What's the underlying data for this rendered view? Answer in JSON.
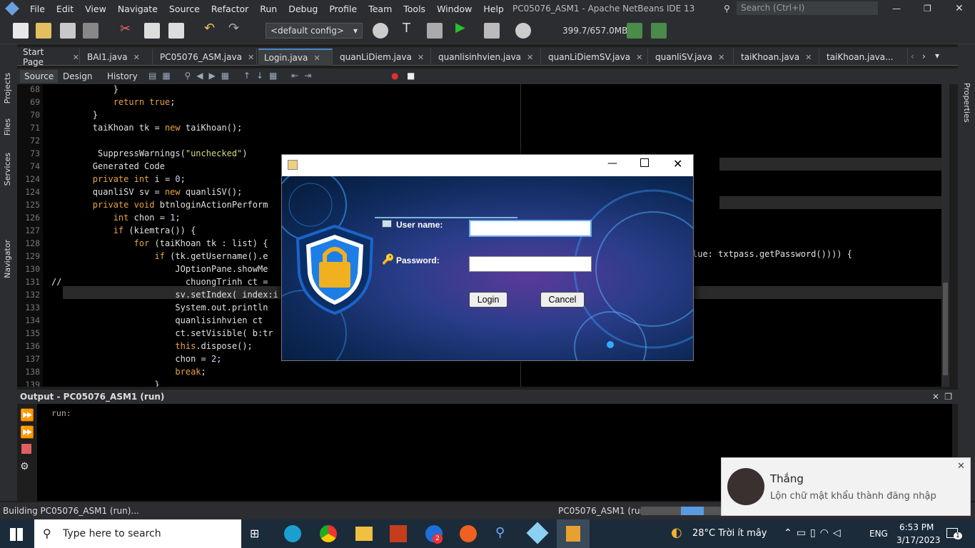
{
  "window": {
    "title": "PC05076_ASM1 - Apache NetBeans IDE 13"
  },
  "menu": [
    "File",
    "Edit",
    "View",
    "Navigate",
    "Source",
    "Refactor",
    "Run",
    "Debug",
    "Profile",
    "Team",
    "Tools",
    "Window",
    "Help"
  ],
  "search": {
    "placeholder": "Search (Ctrl+I)"
  },
  "toolbar": {
    "config": "<default config>",
    "memory": "399.7/657.0MB"
  },
  "tabs": [
    "Start Page",
    "BAI1.java",
    "PC05076_ASM.java",
    "Login.java",
    "quanLiDiem.java",
    "quanlisinhvien.java",
    "quanLiDiemSV.java",
    "quanliSV.java",
    "taiKhoan.java",
    "taiKhoan.java..."
  ],
  "editor_tabs": [
    "Source",
    "Design",
    "History"
  ],
  "side_left": [
    "Projects",
    "Files",
    "Services",
    "Navigator"
  ],
  "side_right": [
    "Properties"
  ],
  "code": [
    {
      "ln": "68",
      "text": "            }"
    },
    {
      "ln": "69",
      "text": "            return true;"
    },
    {
      "ln": "70",
      "text": "        }"
    },
    {
      "ln": "71",
      "text": "        taiKhoan tk = new taiKhoan();"
    },
    {
      "ln": "72",
      "text": ""
    },
    {
      "ln": "73",
      "text": "         SuppressWarnings(\"unchecked\")"
    },
    {
      "ln": "74",
      "text": "        Generated Code"
    },
    {
      "ln": "124",
      "text": "        private int i = 0;"
    },
    {
      "ln": "124",
      "text": "        quanliSV sv = new quanliSV();"
    },
    {
      "ln": "125",
      "text": "        private void btnloginActionPerform"
    },
    {
      "ln": "126",
      "text": "            int chon = 1;"
    },
    {
      "ln": "127",
      "text": "            if (kiemtra()) {"
    },
    {
      "ln": "128",
      "text": "                for (taiKhoan tk : list) {"
    },
    {
      "ln": "129",
      "text": "                    if (tk.getUsername().e"
    },
    {
      "ln": "130",
      "text": "                        JOptionPane.showMe"
    },
    {
      "ln": "131",
      "text": "//                        chuongTrinh ct ="
    },
    {
      "ln": "132",
      "text": "                        sv.setIndex( index:i"
    },
    {
      "ln": "133",
      "text": "                        System.out.println"
    },
    {
      "ln": "134",
      "text": "                        quanlisinhvien ct"
    },
    {
      "ln": "135",
      "text": "                        ct.setVisible( b:tr"
    },
    {
      "ln": "136",
      "text": "                        this.dispose();"
    },
    {
      "ln": "137",
      "text": "                        chon = 2;"
    },
    {
      "ln": "138",
      "text": "                        break;"
    },
    {
      "ln": "139",
      "text": "                    }"
    }
  ],
  "code_right_129": "lue: txtpass.getPassword()))) {",
  "output": {
    "title": "Output - PC05076_ASM1 (run)",
    "text": "run:"
  },
  "status": {
    "left": "Building PC05076_ASM1 (run)...",
    "right": "PC05076_ASM1 (run)"
  },
  "dialog": {
    "username_label": "User name:",
    "password_label": "Password:",
    "login": "Login",
    "cancel": "Cancel"
  },
  "toast": {
    "name": "Thắng",
    "message": "Lộn chữ mật khẩu thành đăng nhập"
  },
  "taskbar": {
    "search_placeholder": "Type here to search",
    "weather": "28°C  Trời ít mây",
    "lang": "ENG",
    "time": "6:53 PM",
    "date": "3/17/2023",
    "badge": "2",
    "notif": "1"
  }
}
